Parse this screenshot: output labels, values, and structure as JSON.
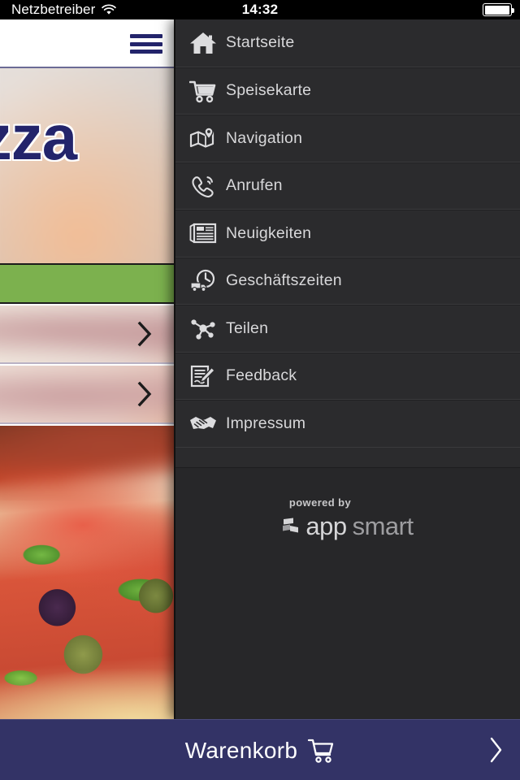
{
  "status_bar": {
    "carrier": "Netzbetreiber",
    "wifi_icon": "wifi-icon",
    "time": "14:32",
    "battery_icon": "battery-full-icon"
  },
  "nav_header": {
    "menu_button_icon": "hamburger-menu-icon",
    "menu_button_color": "#23246b"
  },
  "main_content": {
    "hero_title": "Pizza",
    "hero_title_color": "#23246b",
    "green_bar_color": "#7cb14e",
    "list_rows": [
      {
        "chevron_icon": "chevron-right-icon"
      },
      {
        "chevron_icon": "chevron-right-icon"
      }
    ],
    "photo": "pizza-photo"
  },
  "drawer": {
    "background_color": "#2b2b2d",
    "items": [
      {
        "label": "Startseite",
        "icon": "home-icon"
      },
      {
        "label": "Speisekarte",
        "icon": "shopping-cart-icon"
      },
      {
        "label": "Navigation",
        "icon": "map-pin-icon"
      },
      {
        "label": "Anrufen",
        "icon": "phone-icon"
      },
      {
        "label": "Neuigkeiten",
        "icon": "newspaper-icon"
      },
      {
        "label": "Geschäftszeiten",
        "icon": "delivery-clock-icon"
      },
      {
        "label": "Teilen",
        "icon": "share-icon"
      },
      {
        "label": "Feedback",
        "icon": "note-pencil-icon"
      },
      {
        "label": "Impressum",
        "icon": "handshake-icon"
      }
    ],
    "footer": {
      "powered_by": "powered by",
      "brand_first": "app",
      "brand_second": "smart",
      "logo_icon": "appsmart-blocks-icon"
    }
  },
  "cart_bar": {
    "label": "Warenkorb",
    "cart_icon": "shopping-cart-icon",
    "chevron_icon": "chevron-right-icon",
    "background_color": "#333366"
  }
}
